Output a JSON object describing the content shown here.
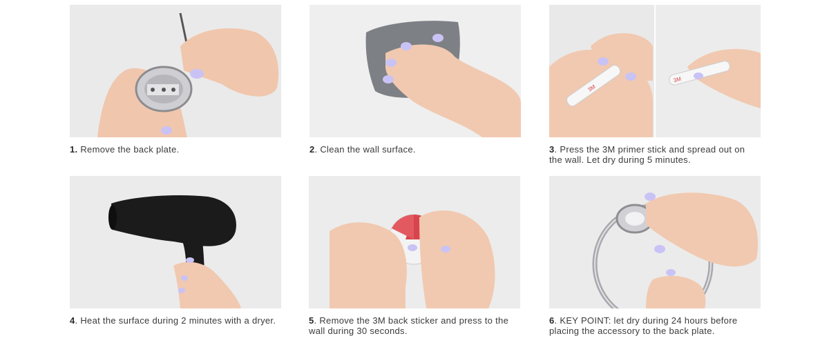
{
  "steps": [
    {
      "number": "1.",
      "text": " Remove the back plate."
    },
    {
      "number": "2",
      "text": ". Clean the wall surface."
    },
    {
      "number": "3",
      "text": ". Press the 3M primer stick and spread out on the wall. Let dry during 5 minutes."
    },
    {
      "number": "4",
      "text": ". Heat the surface during 2 minutes with a dryer."
    },
    {
      "number": "5",
      "text": ". Remove the 3M back sticker and press to the wall during 30 seconds."
    },
    {
      "number": "6",
      "text": ". KEY POINT: let dry during 24 hours before placing the accessory to the back plate."
    }
  ],
  "primer_brand": "3M",
  "colors": {
    "photo_bg": "#ececec",
    "skin": "#f1c9b0",
    "nail": "#c9c3f5",
    "chrome": "#c8c8cc",
    "cloth": "#7d8084",
    "dryer": "#1b1b1b",
    "sticker_red": "#d8444c"
  }
}
